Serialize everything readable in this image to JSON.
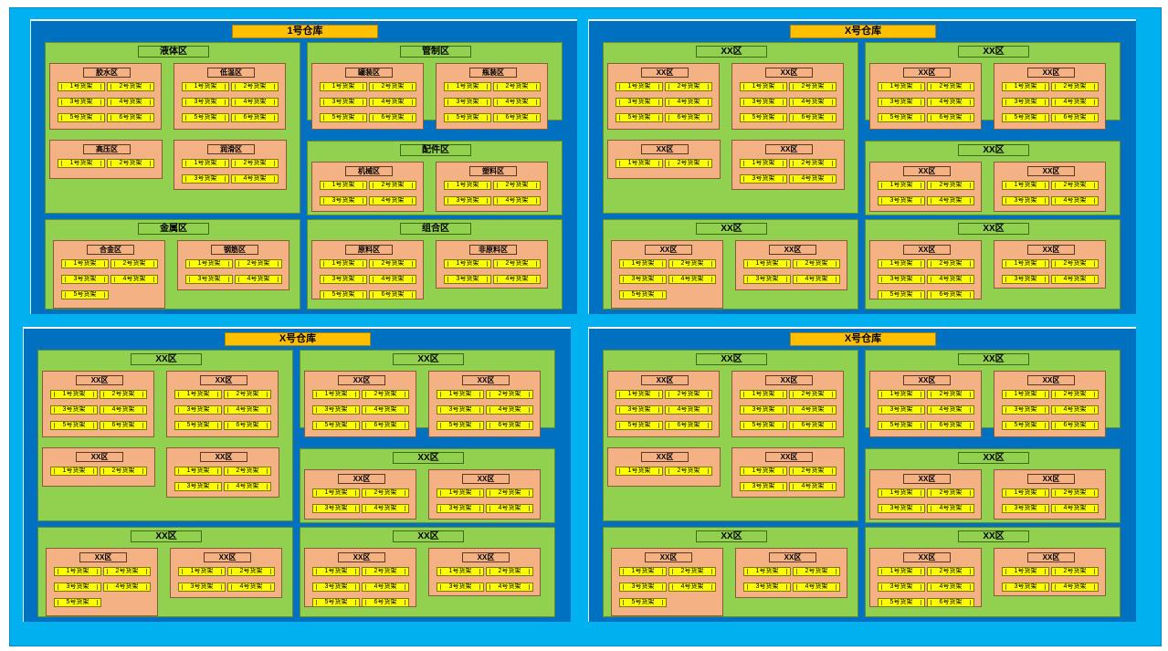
{
  "warehouses": [
    {
      "title": "1号仓库",
      "groups": [
        {
          "title": "液体区",
          "zones": [
            {
              "title": "胶水区",
              "shelves": [
                "1号货架",
                "2号货架",
                "3号货架",
                "4号货架",
                "5号货架",
                "6号货架"
              ]
            },
            {
              "title": "低温区",
              "shelves": [
                "1号货架",
                "2号货架",
                "3号货架",
                "4号货架",
                "5号货架",
                "6号货架"
              ]
            },
            {
              "title": "高压区",
              "shelves": [
                "1号货架",
                "2号货架"
              ]
            },
            {
              "title": "润滑区",
              "shelves": [
                "1号货架",
                "2号货架",
                "3号货架",
                "4号货架"
              ]
            }
          ]
        },
        {
          "title": "管制区",
          "zones": [
            {
              "title": "罐装区",
              "shelves": [
                "1号货架",
                "2号货架",
                "3号货架",
                "4号货架",
                "5号货架",
                "6号货架"
              ]
            },
            {
              "title": "瓶装区",
              "shelves": [
                "1号货架",
                "2号货架",
                "3号货架",
                "4号货架",
                "5号货架",
                "6号货架"
              ]
            }
          ]
        },
        {
          "title": "配件区",
          "zones": [
            {
              "title": "机械区",
              "shelves": [
                "1号货架",
                "2号货架",
                "3号货架",
                "4号货架"
              ]
            },
            {
              "title": "塑料区",
              "shelves": [
                "1号货架",
                "2号货架",
                "3号货架",
                "4号货架"
              ]
            }
          ]
        },
        {
          "title": "金属区",
          "zones": [
            {
              "title": "合金区",
              "shelves": [
                "1号货架",
                "2号货架",
                "3号货架",
                "4号货架",
                "5号货架"
              ]
            },
            {
              "title": "钢筋区",
              "shelves": [
                "1号货架",
                "2号货架",
                "3号货架",
                "4号货架"
              ]
            }
          ]
        },
        {
          "title": "组合区",
          "zones": [
            {
              "title": "原料区",
              "shelves": [
                "1号货架",
                "2号货架",
                "3号货架",
                "4号货架",
                "5号货架",
                "6号货架"
              ]
            },
            {
              "title": "非原料区",
              "shelves": [
                "1号货架",
                "2号货架",
                "3号货架",
                "4号货架"
              ]
            }
          ]
        }
      ]
    },
    {
      "title": "X号仓库",
      "groups": [
        {
          "title": "XX区",
          "zones": [
            {
              "title": "XX区",
              "shelves": [
                "1号货架",
                "2号货架",
                "3号货架",
                "4号货架",
                "5号货架",
                "6号货架"
              ]
            },
            {
              "title": "XX区",
              "shelves": [
                "1号货架",
                "2号货架",
                "3号货架",
                "4号货架",
                "5号货架",
                "6号货架"
              ]
            },
            {
              "title": "XX区",
              "shelves": [
                "1号货架",
                "2号货架"
              ]
            },
            {
              "title": "XX区",
              "shelves": [
                "1号货架",
                "2号货架",
                "3号货架",
                "4号货架"
              ]
            }
          ]
        },
        {
          "title": "XX区",
          "zones": [
            {
              "title": "XX区",
              "shelves": [
                "1号货架",
                "2号货架",
                "3号货架",
                "4号货架",
                "5号货架",
                "6号货架"
              ]
            },
            {
              "title": "XX区",
              "shelves": [
                "1号货架",
                "2号货架",
                "3号货架",
                "4号货架",
                "5号货架",
                "6号货架"
              ]
            }
          ]
        },
        {
          "title": "XX区",
          "zones": [
            {
              "title": "XX区",
              "shelves": [
                "1号货架",
                "2号货架",
                "3号货架",
                "4号货架"
              ]
            },
            {
              "title": "XX区",
              "shelves": [
                "1号货架",
                "2号货架",
                "3号货架",
                "4号货架"
              ]
            }
          ]
        },
        {
          "title": "XX区",
          "zones": [
            {
              "title": "XX区",
              "shelves": [
                "1号货架",
                "2号货架",
                "3号货架",
                "4号货架",
                "5号货架"
              ]
            },
            {
              "title": "XX区",
              "shelves": [
                "1号货架",
                "2号货架",
                "3号货架",
                "4号货架"
              ]
            }
          ]
        },
        {
          "title": "XX区",
          "zones": [
            {
              "title": "XX区",
              "shelves": [
                "1号货架",
                "2号货架",
                "3号货架",
                "4号货架",
                "5号货架",
                "6号货架"
              ]
            },
            {
              "title": "XX区",
              "shelves": [
                "1号货架",
                "2号货架",
                "3号货架",
                "4号货架"
              ]
            }
          ]
        }
      ]
    },
    {
      "title": "X号仓库",
      "groups": [
        {
          "title": "XX区",
          "zones": [
            {
              "title": "XX区",
              "shelves": [
                "1号货架",
                "2号货架",
                "3号货架",
                "4号货架",
                "5号货架",
                "6号货架"
              ]
            },
            {
              "title": "XX区",
              "shelves": [
                "1号货架",
                "2号货架",
                "3号货架",
                "4号货架",
                "5号货架",
                "6号货架"
              ]
            },
            {
              "title": "XX区",
              "shelves": [
                "1号货架",
                "2号货架"
              ]
            },
            {
              "title": "XX区",
              "shelves": [
                "1号货架",
                "2号货架",
                "3号货架",
                "4号货架"
              ]
            }
          ]
        },
        {
          "title": "XX区",
          "zones": [
            {
              "title": "XX区",
              "shelves": [
                "1号货架",
                "2号货架",
                "3号货架",
                "4号货架",
                "5号货架",
                "6号货架"
              ]
            },
            {
              "title": "XX区",
              "shelves": [
                "1号货架",
                "2号货架",
                "3号货架",
                "4号货架",
                "5号货架",
                "6号货架"
              ]
            }
          ]
        },
        {
          "title": "XX区",
          "zones": [
            {
              "title": "XX区",
              "shelves": [
                "1号货架",
                "2号货架",
                "3号货架",
                "4号货架"
              ]
            },
            {
              "title": "XX区",
              "shelves": [
                "1号货架",
                "2号货架",
                "3号货架",
                "4号货架"
              ]
            }
          ]
        },
        {
          "title": "XX区",
          "zones": [
            {
              "title": "XX区",
              "shelves": [
                "1号货架",
                "2号货架",
                "3号货架",
                "4号货架",
                "5号货架"
              ]
            },
            {
              "title": "XX区",
              "shelves": [
                "1号货架",
                "2号货架",
                "3号货架",
                "4号货架"
              ]
            }
          ]
        },
        {
          "title": "XX区",
          "zones": [
            {
              "title": "XX区",
              "shelves": [
                "1号货架",
                "2号货架",
                "3号货架",
                "4号货架",
                "5号货架",
                "6号货架"
              ]
            },
            {
              "title": "XX区",
              "shelves": [
                "1号货架",
                "2号货架",
                "3号货架",
                "4号货架"
              ]
            }
          ]
        }
      ]
    },
    {
      "title": "X号仓库",
      "groups": [
        {
          "title": "XX区",
          "zones": [
            {
              "title": "XX区",
              "shelves": [
                "1号货架",
                "2号货架",
                "3号货架",
                "4号货架",
                "5号货架",
                "6号货架"
              ]
            },
            {
              "title": "XX区",
              "shelves": [
                "1号货架",
                "2号货架",
                "3号货架",
                "4号货架",
                "5号货架",
                "6号货架"
              ]
            },
            {
              "title": "XX区",
              "shelves": [
                "1号货架",
                "2号货架"
              ]
            },
            {
              "title": "XX区",
              "shelves": [
                "1号货架",
                "2号货架",
                "3号货架",
                "4号货架"
              ]
            }
          ]
        },
        {
          "title": "XX区",
          "zones": [
            {
              "title": "XX区",
              "shelves": [
                "1号货架",
                "2号货架",
                "3号货架",
                "4号货架",
                "5号货架",
                "6号货架"
              ]
            },
            {
              "title": "XX区",
              "shelves": [
                "1号货架",
                "2号货架",
                "3号货架",
                "4号货架",
                "5号货架",
                "6号货架"
              ]
            }
          ]
        },
        {
          "title": "XX区",
          "zones": [
            {
              "title": "XX区",
              "shelves": [
                "1号货架",
                "2号货架",
                "3号货架",
                "4号货架"
              ]
            },
            {
              "title": "XX区",
              "shelves": [
                "1号货架",
                "2号货架",
                "3号货架",
                "4号货架"
              ]
            }
          ]
        },
        {
          "title": "XX区",
          "zones": [
            {
              "title": "XX区",
              "shelves": [
                "1号货架",
                "2号货架",
                "3号货架",
                "4号货架",
                "5号货架"
              ]
            },
            {
              "title": "XX区",
              "shelves": [
                "1号货架",
                "2号货架",
                "3号货架",
                "4号货架"
              ]
            }
          ]
        },
        {
          "title": "XX区",
          "zones": [
            {
              "title": "XX区",
              "shelves": [
                "1号货架",
                "2号货架",
                "3号货架",
                "4号货架",
                "5号货架",
                "6号货架"
              ]
            },
            {
              "title": "XX区",
              "shelves": [
                "1号货架",
                "2号货架",
                "3号货架",
                "4号货架"
              ]
            }
          ]
        }
      ]
    }
  ]
}
